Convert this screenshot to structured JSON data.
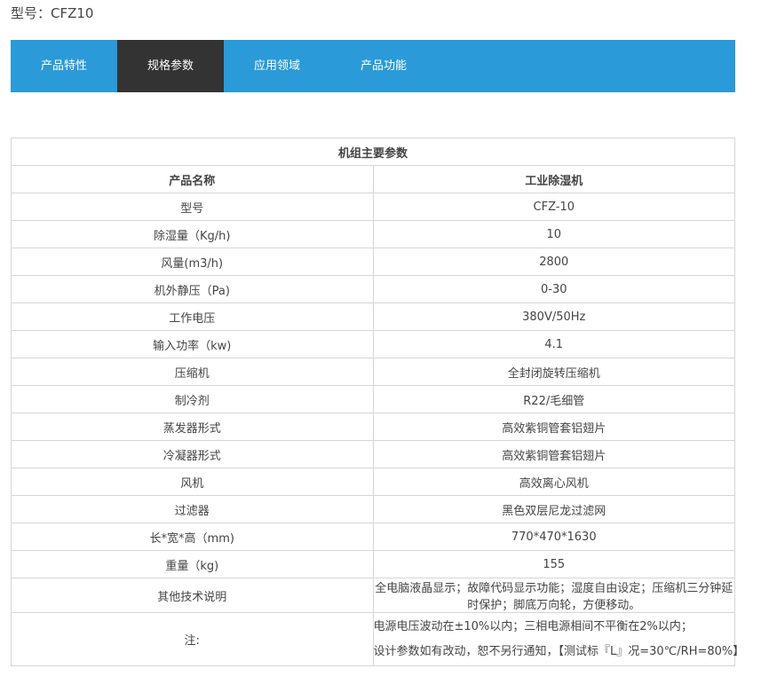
{
  "model": {
    "title": "型号：CFZ10"
  },
  "tabs": [
    {
      "label": "产品特性",
      "active": false
    },
    {
      "label": "规格参数",
      "active": true
    },
    {
      "label": "应用领域",
      "active": false
    },
    {
      "label": "产品功能",
      "active": false
    }
  ],
  "colors": {
    "tab_bar": "#2a9ad8",
    "tab_active": "#333333",
    "border": "#d6d6d6"
  },
  "table": {
    "caption": "机组主要参数",
    "header": {
      "label": "产品名称",
      "value": "工业除湿机"
    },
    "rows": [
      {
        "label": "型号",
        "value": "CFZ-10"
      },
      {
        "label": "除湿量（Kg/h)",
        "value": "10"
      },
      {
        "label": "风量(m3/h)",
        "value": "2800"
      },
      {
        "label": "机外静压（Pa)",
        "value": "0-30"
      },
      {
        "label": "工作电压",
        "value": "380V/50Hz"
      },
      {
        "label": "输入功率（kw)",
        "value": "4.1"
      },
      {
        "label": "压缩机",
        "value": "全封闭旋转压缩机"
      },
      {
        "label": "制冷剂",
        "value": "R22/毛细管"
      },
      {
        "label": "蒸发器形式",
        "value": "高效紫铜管套铝翅片"
      },
      {
        "label": "冷凝器形式",
        "value": "高效紫铜管套铝翅片"
      },
      {
        "label": "风机",
        "value": "高效离心风机"
      },
      {
        "label": "过滤器",
        "value": "黑色双层尼龙过滤网"
      },
      {
        "label": "长*宽*高（mm)",
        "value": "770*470*1630"
      },
      {
        "label": "重量（kg)",
        "value": "155"
      },
      {
        "label": "其他技术说明",
        "value": "全电脑液晶显示；故障代码显示功能；湿度自由设定；压缩机三分钟延时保护；脚底万向轮，方便移动。"
      }
    ],
    "notes": {
      "label": "注:",
      "lines": [
        "电源电压波动在±10%以内；三相电源相间不平衡在2%以内；",
        "设计参数如有改动，恕不另行通知，【测试标『L』况=30℃/RH=80%】"
      ]
    }
  }
}
